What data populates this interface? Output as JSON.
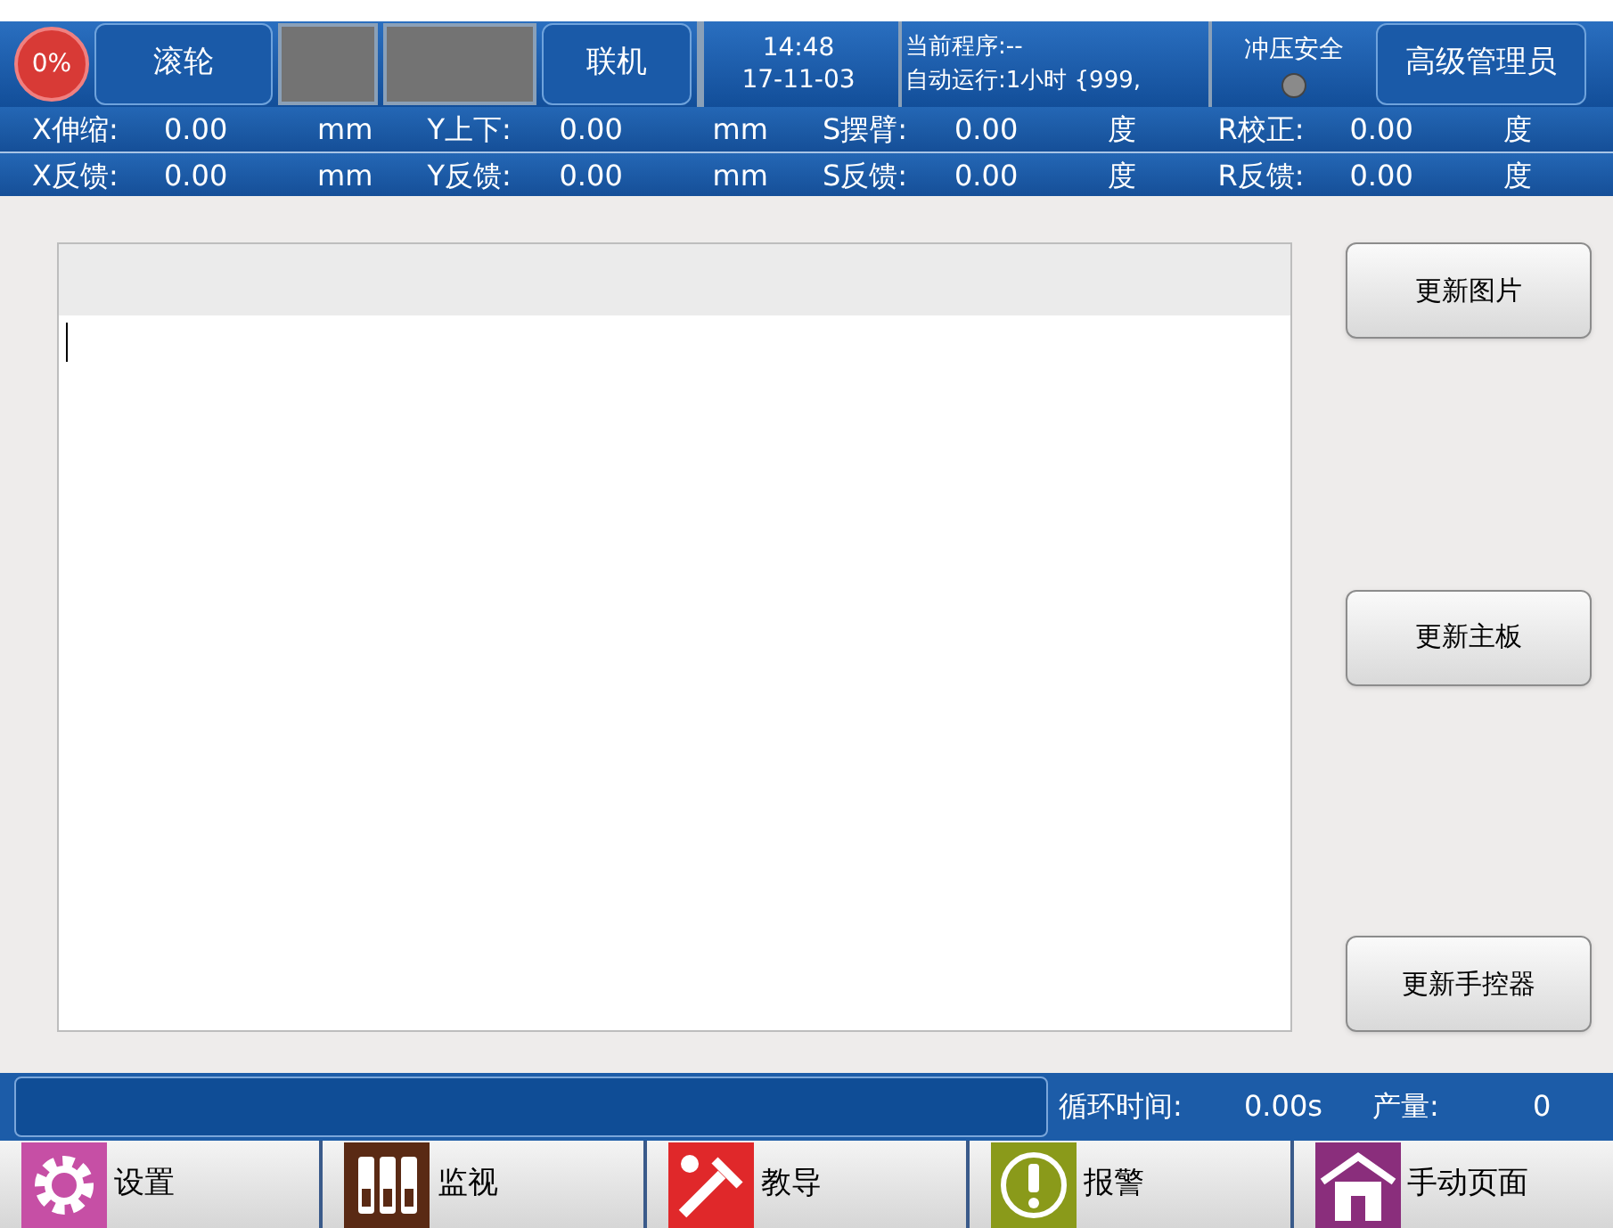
{
  "top_bar": {
    "progress": "0%",
    "mode_button": "滚轮",
    "online_button": "联机",
    "time": "14:48",
    "date": "17-11-03",
    "program_label": "当前程序:--",
    "auto_run": "自动运行:1小时 {999,",
    "safety_label": "冲压安全",
    "safety_lamp_on": false,
    "user_button": "高级管理员"
  },
  "readouts": [
    [
      {
        "label": "X伸缩:",
        "value": "0.00",
        "unit": "mm"
      },
      {
        "label": "Y上下:",
        "value": "0.00",
        "unit": "mm"
      },
      {
        "label": "S摆臂:",
        "value": "0.00",
        "unit": "度"
      },
      {
        "label": "R校正:",
        "value": "0.00",
        "unit": "度"
      }
    ],
    [
      {
        "label": "X反馈:",
        "value": "0.00",
        "unit": "mm"
      },
      {
        "label": "Y反馈:",
        "value": "0.00",
        "unit": "mm"
      },
      {
        "label": "S反馈:",
        "value": "0.00",
        "unit": "度"
      },
      {
        "label": "R反馈:",
        "value": "0.00",
        "unit": "度"
      }
    ]
  ],
  "update_buttons": [
    "更新图片",
    "更新主板",
    "更新手控器"
  ],
  "status_bar": {
    "cycle_time_label": "循环时间:",
    "cycle_time": "0.00s",
    "output_label": "产量:",
    "output": "0"
  },
  "nav": [
    {
      "label": "设置",
      "kind": "gear",
      "color": "#c64fa5"
    },
    {
      "label": "监视",
      "kind": "binders",
      "color": "#5a2a14"
    },
    {
      "label": "教导",
      "kind": "tools",
      "color": "#e0282a"
    },
    {
      "label": "报警",
      "kind": "alert",
      "color": "#8a9a1a"
    },
    {
      "label": "手动页面",
      "kind": "home",
      "color": "#8a2e7c"
    }
  ]
}
